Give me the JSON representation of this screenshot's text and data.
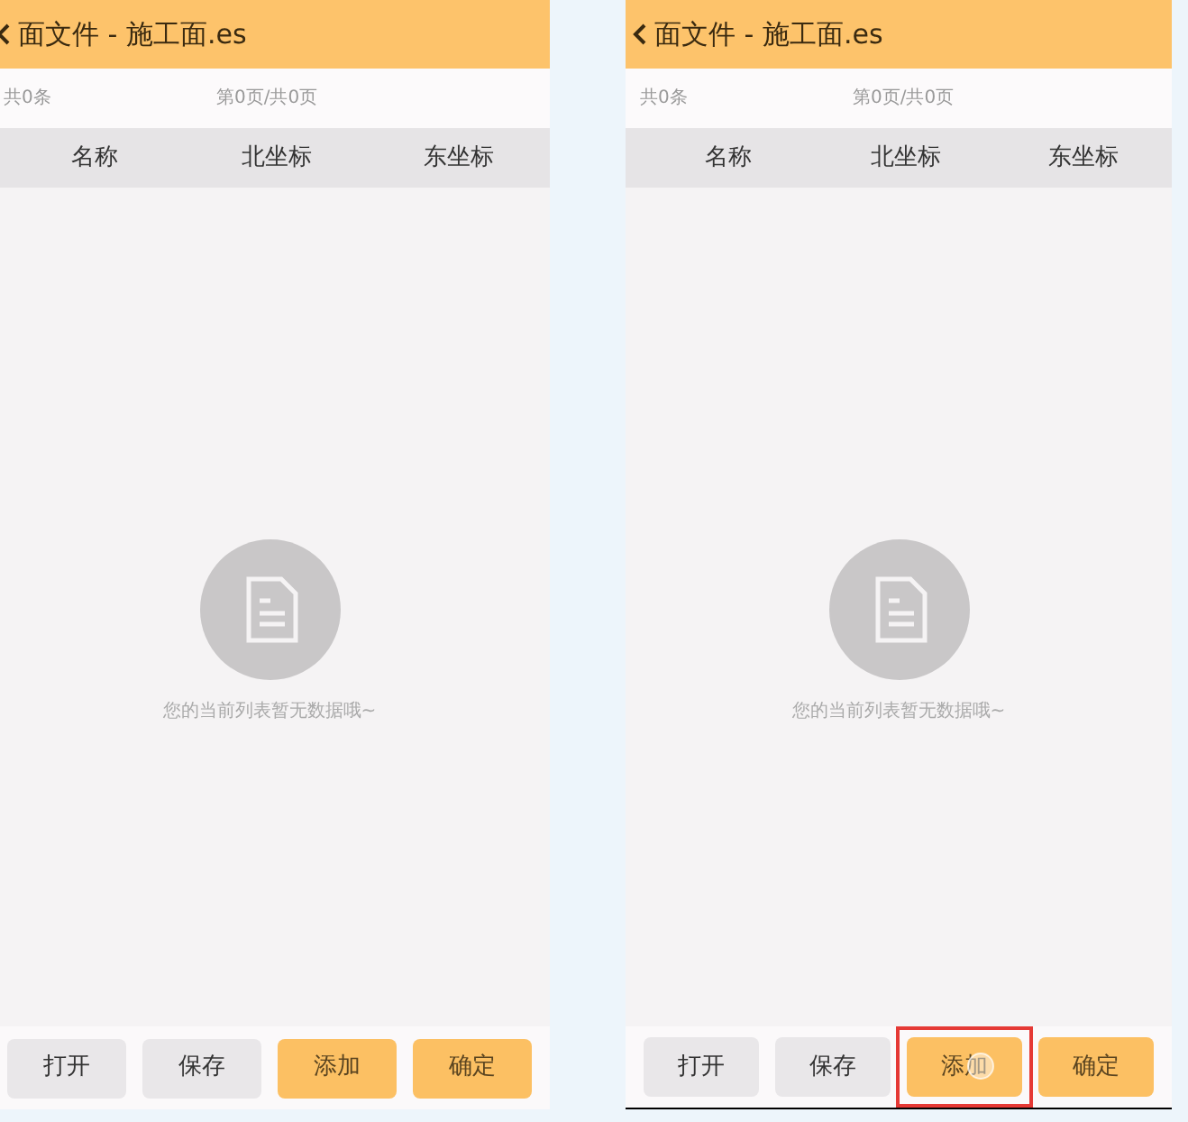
{
  "screens": [
    {
      "title": "面文件 - 施工面.es",
      "count": "共0条",
      "page": "第0页/共0页",
      "columns": [
        "名称",
        "北坐标",
        "东坐标"
      ],
      "empty_message": "您的当前列表暂无数据哦~",
      "buttons": [
        {
          "label": "打开",
          "kind": "secondary",
          "highlighted": false
        },
        {
          "label": "保存",
          "kind": "secondary",
          "highlighted": false
        },
        {
          "label": "添加",
          "kind": "primary",
          "highlighted": false
        },
        {
          "label": "确定",
          "kind": "primary",
          "highlighted": false
        }
      ]
    },
    {
      "title": "面文件 - 施工面.es",
      "count": "共0条",
      "page": "第0页/共0页",
      "columns": [
        "名称",
        "北坐标",
        "东坐标"
      ],
      "empty_message": "您的当前列表暂无数据哦~",
      "buttons": [
        {
          "label": "打开",
          "kind": "secondary",
          "highlighted": false
        },
        {
          "label": "保存",
          "kind": "secondary",
          "highlighted": false
        },
        {
          "label": "添加",
          "kind": "primary",
          "highlighted": true
        },
        {
          "label": "确定",
          "kind": "primary",
          "highlighted": false
        }
      ]
    }
  ]
}
